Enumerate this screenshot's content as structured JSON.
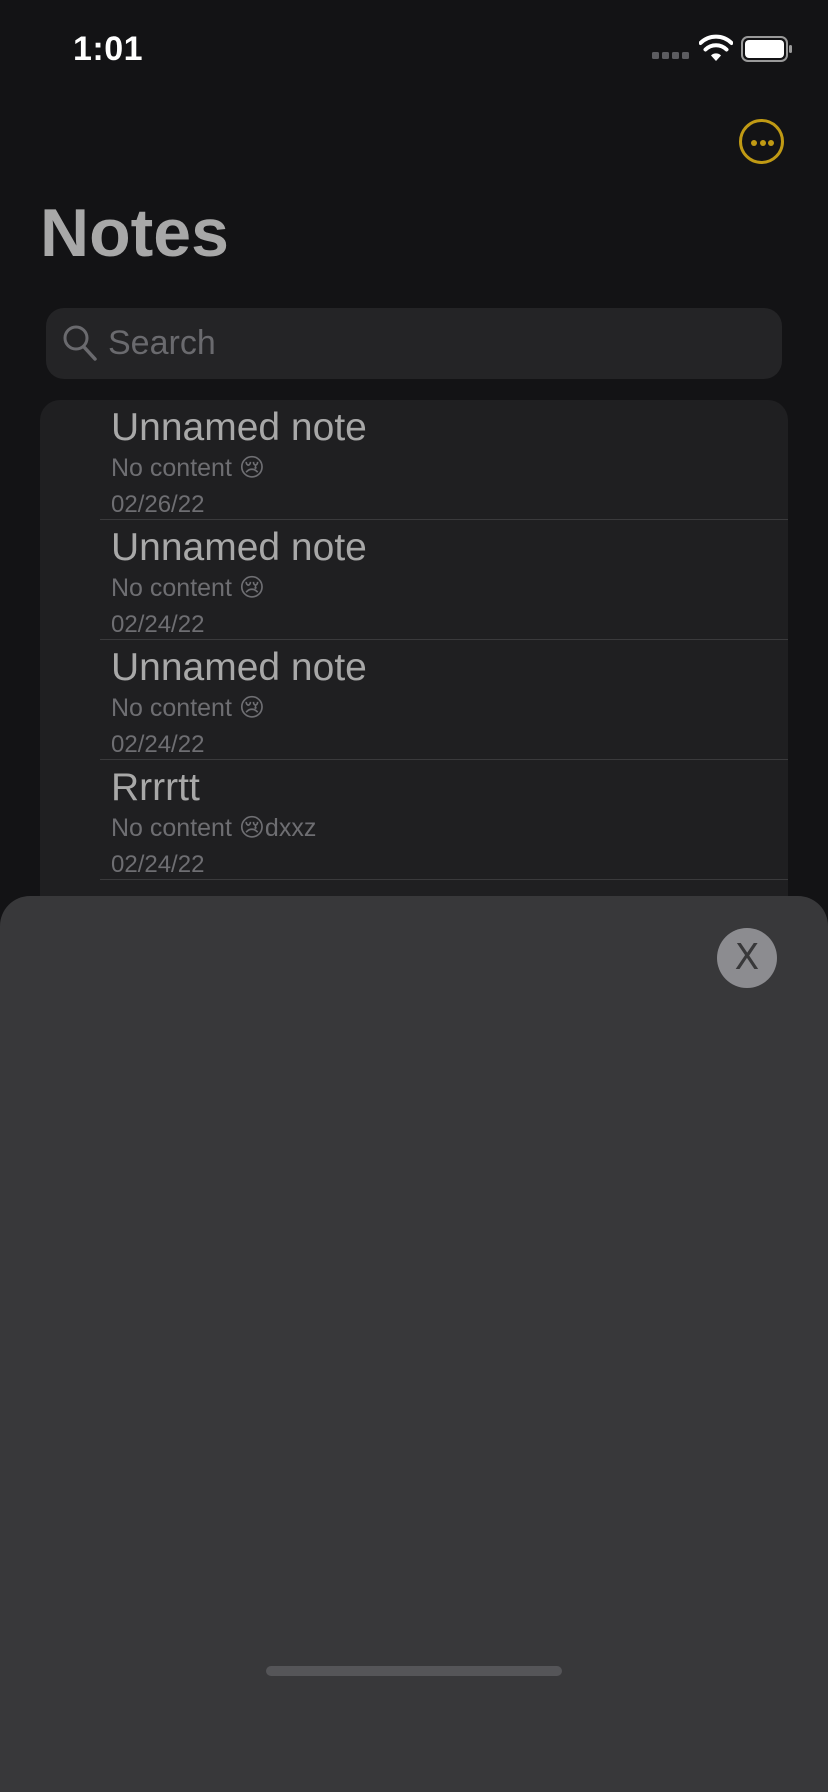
{
  "status_bar": {
    "time": "1:01"
  },
  "header": {
    "title": "Notes",
    "more_icon": "ellipsis-circle-icon",
    "accent_color": "#c09a14"
  },
  "search": {
    "placeholder": "Search",
    "value": ""
  },
  "notes": [
    {
      "title": "Unnamed note",
      "preview": "No content 😢",
      "date": "02/26/22"
    },
    {
      "title": "Unnamed note",
      "preview": "No content 😢",
      "date": "02/24/22"
    },
    {
      "title": "Unnamed note",
      "preview": "No content 😢",
      "date": "02/24/22"
    },
    {
      "title": "Rrrrtt",
      "preview": "No content 😢dxxz",
      "date": "02/24/22"
    }
  ],
  "sheet": {
    "close_label": "X"
  }
}
